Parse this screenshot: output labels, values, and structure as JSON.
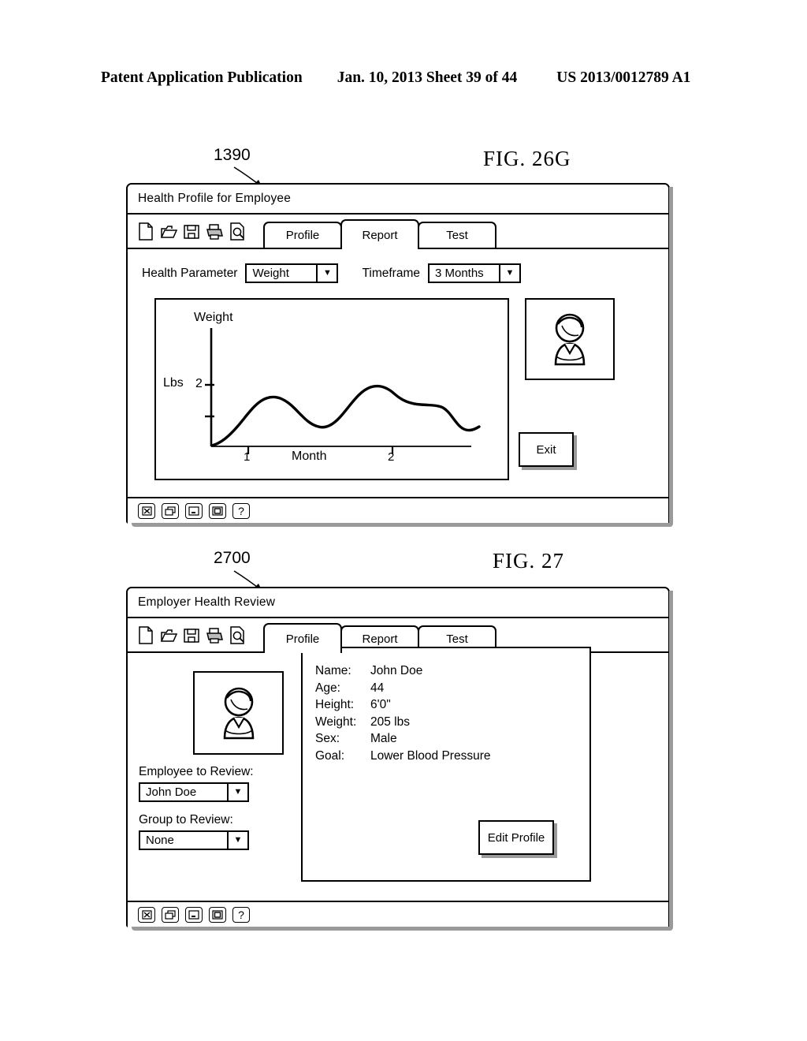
{
  "publication": {
    "left": "Patent Application Publication",
    "date_sheet": "Jan. 10, 2013  Sheet 39 of 44",
    "number": "US 2013/0012789 A1"
  },
  "figures": [
    {
      "label": "FIG. 26G",
      "window_ref": "1390",
      "window": {
        "title": "Health Profile for Employee",
        "toolbar_icons": [
          "new-document-icon",
          "open-folder-icon",
          "save-floppy-icon",
          "print-icon",
          "print-preview-icon"
        ],
        "tabs": [
          {
            "label": "Profile",
            "active": false,
            "ref": "2102"
          },
          {
            "label": "Report",
            "active": true,
            "ref": "2104"
          },
          {
            "label": "Test",
            "active": false,
            "ref": "2106"
          }
        ],
        "statusbar_buttons": [
          "close-icon",
          "restore-cascade-icon",
          "minimize-icon",
          "maximize-icon",
          "help-icon"
        ]
      },
      "controls": [
        {
          "label": "Health Parameter",
          "value": "Weight",
          "ref": "2674",
          "name": "health-parameter-select"
        },
        {
          "label": "Timeframe",
          "value": "3 Months",
          "ref": "2676",
          "name": "timeframe-select"
        }
      ],
      "chart_ref": "2672",
      "avatar_ref": "2110",
      "panel_ref": "2670",
      "screen_ref": "2600",
      "exit_button": {
        "label": "Exit",
        "ref": "2678"
      }
    },
    {
      "label": "FIG. 27",
      "window_ref": "2700",
      "window": {
        "title": "Employer Health Review",
        "toolbar_icons": [
          "new-document-icon",
          "open-folder-icon",
          "save-floppy-icon",
          "print-icon",
          "print-preview-icon"
        ],
        "tabs": [
          {
            "label": "Profile",
            "active": true,
            "ref": "2102"
          },
          {
            "label": "Report",
            "active": false,
            "ref": "2104"
          },
          {
            "label": "Test",
            "active": false,
            "ref": "2106"
          }
        ],
        "statusbar_buttons": [
          "close-icon",
          "restore-cascade-icon",
          "minimize-icon",
          "maximize-icon",
          "help-icon"
        ]
      },
      "controls": [
        {
          "label": "Employee to Review:",
          "value": "John Doe",
          "ref": "2702",
          "name": "employee-to-review-select"
        },
        {
          "label": "Group to Review:",
          "value": "None",
          "ref": "2706",
          "name": "group-to-review-select"
        }
      ],
      "profile": {
        "ref": "2704",
        "rows": [
          {
            "label": "Name:",
            "value": "John Doe"
          },
          {
            "label": "Age:",
            "value": "44"
          },
          {
            "label": "Height:",
            "value": "6'0\""
          },
          {
            "label": "Weight:",
            "value": "205 lbs"
          },
          {
            "label": "Sex:",
            "value": "Male"
          },
          {
            "label": "Goal:",
            "value": "Lower Blood Pressure"
          }
        ]
      },
      "edit_button": {
        "label": "Edit Profile"
      }
    }
  ],
  "chart_data": {
    "type": "line",
    "title": "Weight",
    "ylabel": "Weight",
    "yunit": "Lbs",
    "xlabel": "Month",
    "xticks": [
      "1",
      "2"
    ],
    "yticks": [
      "2",
      ""
    ],
    "grid": false,
    "legend": "none",
    "x": [
      0.0,
      0.15,
      0.3,
      0.45,
      0.6,
      0.75,
      0.9,
      1.05,
      1.2,
      1.35,
      1.5,
      1.65,
      1.8,
      1.95,
      2.1,
      2.25,
      2.4,
      2.55,
      2.7
    ],
    "values": [
      0.0,
      0.22,
      0.62,
      1.18,
      1.58,
      1.7,
      1.66,
      1.48,
      1.27,
      1.18,
      1.28,
      1.64,
      1.96,
      2.08,
      2.02,
      1.93,
      1.9,
      1.42,
      1.14
    ],
    "units_note": "axis values unlabeled except tick '2' on Lbs axis"
  }
}
